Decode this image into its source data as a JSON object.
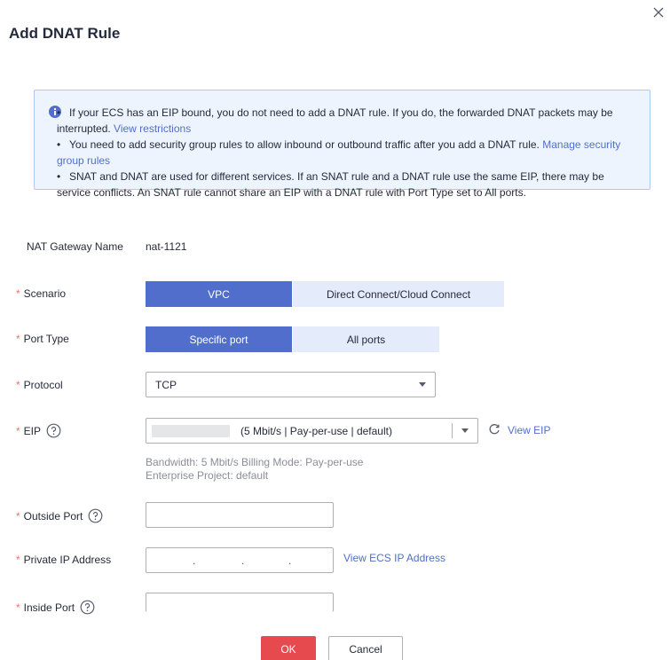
{
  "dialog": {
    "title": "Add DNAT Rule",
    "close_icon": "close-icon"
  },
  "notice": {
    "icon": "info-icon",
    "items": [
      {
        "text": "If your ECS has an EIP bound, you do not need to add a DNAT rule. If you do, the forwarded DNAT packets may be interrupted. ",
        "link": "View restrictions"
      },
      {
        "text": "You need to add security group rules to allow inbound or outbound traffic after you add a DNAT rule. ",
        "link": "Manage security group rules"
      },
      {
        "text": "SNAT and DNAT are used for different services. If an SNAT rule and a DNAT rule use the same EIP, there may be service conflicts. An SNAT rule cannot share an EIP with a DNAT rule with Port Type set to All ports.",
        "link": ""
      }
    ],
    "bullet": "•"
  },
  "form": {
    "required_mark": "*",
    "nat_gateway": {
      "label": "NAT Gateway Name",
      "value": "nat-1121"
    },
    "scenario": {
      "label": "Scenario",
      "options": [
        "VPC",
        "Direct Connect/Cloud Connect"
      ],
      "selected": "VPC"
    },
    "port_type": {
      "label": "Port Type",
      "options": [
        "Specific port",
        "All ports"
      ],
      "selected": "Specific port"
    },
    "protocol": {
      "label": "Protocol",
      "value": "TCP"
    },
    "eip": {
      "label": "EIP",
      "value": "(5 Mbit/s | Pay-per-use | default)",
      "link": "View EIP",
      "hint_line1": "Bandwidth: 5 Mbit/s  Billing Mode: Pay-per-use",
      "hint_line2": "Enterprise Project: default"
    },
    "outside_port": {
      "label": "Outside Port",
      "value": ""
    },
    "private_ip": {
      "label": "Private IP Address",
      "link": "View ECS IP Address",
      "dot": "."
    },
    "inside_port": {
      "label": "Inside Port",
      "value": ""
    }
  },
  "footer": {
    "ok_label": "OK",
    "cancel_label": "Cancel"
  },
  "colors": {
    "accent": "#526ecc",
    "danger": "#e64a4f",
    "required": "#f66f6a"
  }
}
